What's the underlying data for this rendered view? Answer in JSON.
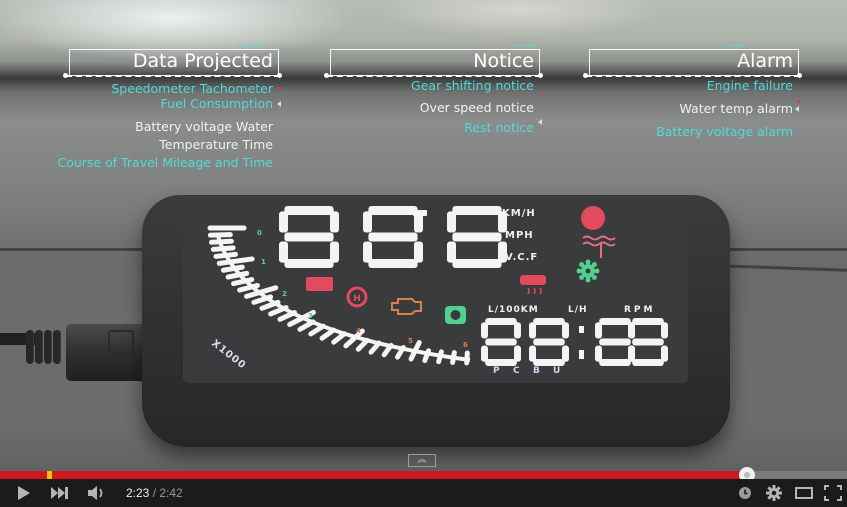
{
  "video": {
    "captions": [
      {
        "title": "Data Projected",
        "items": [
          {
            "text": "Speedometer Tachometer",
            "color": "cyan"
          },
          {
            "text": "Fuel Consumption",
            "color": "cyan"
          },
          {
            "text": "Battery voltage Water",
            "color": "white"
          },
          {
            "text": "Temperature Time",
            "color": "white"
          },
          {
            "text": "Course of Travel Mileage and Time",
            "color": "cyan"
          }
        ]
      },
      {
        "title": "Notice",
        "items": [
          {
            "text": "Gear shifting notice",
            "color": "cyan"
          },
          {
            "text": "Over speed notice",
            "color": "white"
          },
          {
            "text": "Rest notice",
            "color": "cyan"
          }
        ]
      },
      {
        "title": "Alarm",
        "items": [
          {
            "text": "Engine failure",
            "color": "cyan"
          },
          {
            "text": "Water temp alarm",
            "color": "white"
          },
          {
            "text": "Battery voltage alarm",
            "color": "cyan"
          }
        ]
      }
    ],
    "hud": {
      "speed_digits": "888",
      "speed_units": [
        "KM/H",
        "MPH",
        "V.C.F"
      ],
      "tach_numbers": [
        "0",
        "1",
        "2",
        "3",
        "4",
        "5",
        "6"
      ],
      "tach_multiplier": "X1000",
      "lower_units": [
        "L/100KM",
        "L/H",
        "RPM"
      ],
      "lower_digits": "88:88",
      "gear_letters": [
        "P",
        "C",
        "B",
        "U"
      ],
      "icons": [
        "battery-icon",
        "gear-shift-icon",
        "engine-icon",
        "rest-icon",
        "overspeed-icon",
        "water-temp-icon",
        "settings-icon",
        "coffee-icon"
      ]
    },
    "colors": {
      "cyan_text": "#52d9d9",
      "alarm_red": "#e24a5e",
      "notice_green": "#53d08e",
      "engine_orange": "#d9804a"
    }
  },
  "player": {
    "progress_played_fraction": 0.882,
    "ad_marker_fraction": 0.058,
    "time_current": "2:23",
    "time_separator": " / ",
    "time_total": "2:42",
    "colors": {
      "progress_played": "#cc181e",
      "progress_unplayed": "#7b7b7b",
      "ad_marker": "#f5c400",
      "controls_bg": "#1b1b1b"
    },
    "icons": {
      "play": "play-icon",
      "next": "next-icon",
      "volume": "volume-icon",
      "watch_later": "watch-later-icon",
      "settings": "settings-icon",
      "theater": "theater-mode-icon",
      "fullscreen": "fullscreen-icon",
      "collapse": "chevron-up-icon"
    }
  }
}
